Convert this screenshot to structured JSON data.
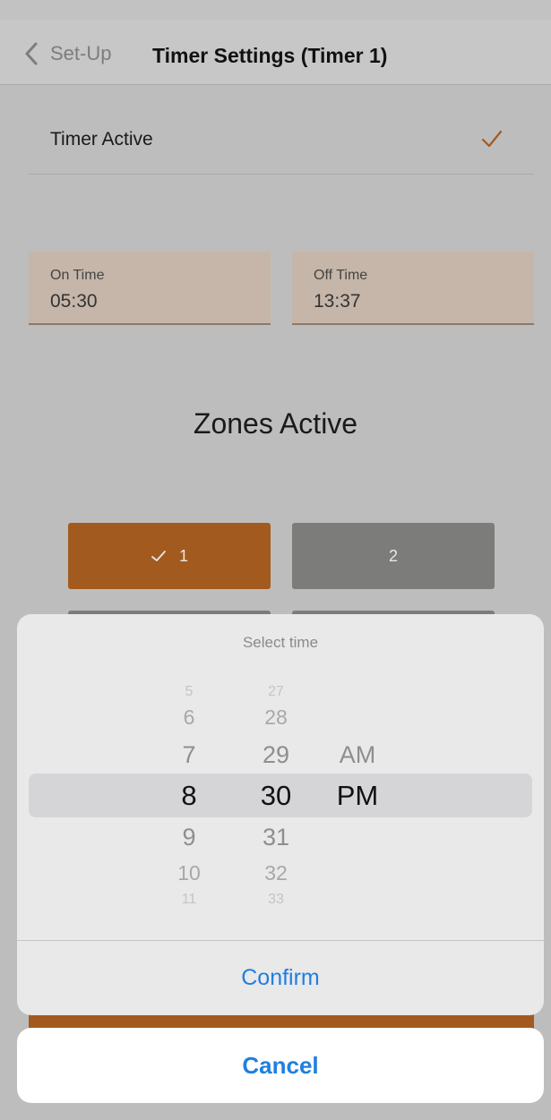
{
  "nav": {
    "back_label": "Set-Up",
    "title": "Timer Settings (Timer 1)"
  },
  "timer_active": {
    "label": "Timer Active",
    "checked": true
  },
  "on_time": {
    "caption": "On Time",
    "value": "05:30"
  },
  "off_time": {
    "caption": "Off Time",
    "value": "13:37"
  },
  "zones": {
    "title": "Zones Active",
    "items": [
      {
        "label": "1",
        "active": true
      },
      {
        "label": "2",
        "active": false
      }
    ]
  },
  "picker": {
    "title": "Select time",
    "hours": [
      "5",
      "6",
      "7",
      "8",
      "9",
      "10",
      "11"
    ],
    "minutes": [
      "27",
      "28",
      "29",
      "30",
      "31",
      "32",
      "33"
    ],
    "periods": [
      "AM",
      "PM"
    ],
    "selected": {
      "hour": "8",
      "minute": "30",
      "period": "PM"
    },
    "confirm_label": "Confirm",
    "cancel_label": "Cancel"
  },
  "colors": {
    "accent": "#a35a1e",
    "link": "#1f7fe0",
    "inactive_zone": "#7c7d7b"
  }
}
